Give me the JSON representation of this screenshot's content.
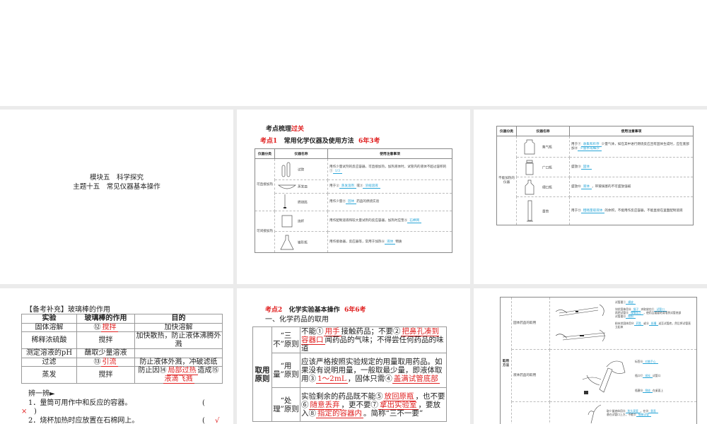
{
  "slide1": {
    "line1": "模块五　科学探究",
    "line2": "主题十五　常见仪器基本操作"
  },
  "slide2": {
    "heading_a": "考点梳理",
    "heading_b": "过关",
    "kp_label": "考点1",
    "kp_title": "常用化学仪器及使用方法",
    "kp_freq": "6年3考",
    "headers": [
      "仪器分类",
      "仪器名称",
      "使用注意事项"
    ],
    "groups": [
      "可直接加热",
      "可间接加热"
    ],
    "rows": [
      {
        "name": "试管",
        "pre": "用作少量试剂的反应容器，可直接加热，加热液体时，试管内的液体不超过容积的①",
        "a1": "1/3"
      },
      {
        "name": "蒸发皿",
        "pre": "用于②",
        "a1": "蒸发溶剂",
        "mid": "或③",
        "a2": "浓缩溶液"
      },
      {
        "name": "燃烧匙",
        "pre": "用作少量④",
        "a1": "固体",
        "post": "药品的燃烧实验"
      },
      {
        "name": "烧杯",
        "pre": "用作配制溶液和较大量试剂的反应容器，加热时应垫⑤",
        "a1": "石棉网"
      },
      {
        "name": "锥形瓶",
        "pre": "用作接收器，反应器等，常用于加热⑥",
        "a1": "液体",
        "post": "物质"
      }
    ]
  },
  "slide3": {
    "headers": [
      "仪器分类",
      "仪器名称",
      "使用注意事项"
    ],
    "group": "不能加热的仪器",
    "rows": [
      {
        "name": "集气瓶",
        "pre": "用于⑦",
        "a1": "收集和贮存",
        "mid": "少量气体，如在其中进行燃烧反应且有固体生成时，应在底部加⑧",
        "a2": "少量水或细沙"
      },
      {
        "name": "广口瓶",
        "pre": "盛放⑨",
        "a1": "固体"
      },
      {
        "name": "细口瓶",
        "pre": "盛放⑩",
        "a1": "液体",
        "post": "，带玻璃塞的不可盛放强碱"
      },
      {
        "name": "量筒",
        "pre": "用于⑪",
        "a1": "粗略量取液体",
        "post": "的体积，不能用作反应容器，不能直接在里面配制溶液"
      }
    ]
  },
  "slide4": {
    "title": "【备考补充】玻璃棒的作用",
    "headers": [
      "实验",
      "玻璃棒的作用",
      "目的"
    ],
    "rows": [
      {
        "exp": "固体溶解",
        "num": "⑫",
        "role": "搅拌",
        "purpose": "加快溶解"
      },
      {
        "exp": "稀释浓硫酸",
        "role": "搅拌",
        "purpose": "加快散热，防止液体沸腾外溅"
      },
      {
        "exp": "测定溶液的pH",
        "role": "蘸取少量溶液",
        "purpose": ""
      },
      {
        "exp": "过滤",
        "num": "⑬",
        "role": "引流",
        "purpose": "防止液体外溅，冲破滤纸"
      },
      {
        "exp": "蒸发",
        "role": "搅拌",
        "p_pre": "防止因⑭",
        "p_a1": "局部过热",
        "p_mid": "造成⑮",
        "p_a2": "液滴飞溅"
      }
    ],
    "quiz_title": "辨一辨►",
    "q1": "1．量筒可用作中和反应的容器。",
    "q1_ans": "×",
    "q2": "2．烧杯加热时应放置在石棉网上。",
    "q2_ans": "√",
    "paren_open": "(",
    "paren_close": ")"
  },
  "slide5": {
    "kp_label": "考点2",
    "kp_title": "化学实验基本操作",
    "kp_freq": "6年6考",
    "sub": "一、化学药品的取用",
    "group": "取用原则",
    "rows": [
      {
        "label": "“三不”原则",
        "t1": "不能①",
        "a1": "用手",
        "t2": "接触药品；不要②",
        "a2": "把鼻孔凑到容器口",
        "t3": "闻药品的气味；不得尝任何药品的味道"
      },
      {
        "label": "“用量”原则",
        "t1": "应该严格按照实验规定的用量取用药品。如果没有说明用量，一般取最少量，即液体取用③",
        "a1": "1～2mL",
        "t2": "，固体只需④",
        "a2": "盖满试管底部"
      },
      {
        "label": "“处理”原则",
        "t1": "实验剩余的药品既不能⑤",
        "a1": "放回原瓶",
        "t2": "，也不要⑥",
        "a2": "随意丢弃",
        "t3": "，更不要⑦",
        "a3": "拿出实验室",
        "t4": "，要放入⑧",
        "a4": "指定的容器内",
        "t5": "。简称“三不一要”"
      }
    ]
  },
  "slide6": {
    "group": "取用方法",
    "rows": [
      "固体药品的取用",
      "液体药品的取用"
    ],
    "notes": [
      {
        "pre": "试管要①",
        "a": "横放"
      },
      {
        "pre": "块状固体用⑩",
        "a": "镊子",
        "mid": "夹取放在⑪",
        "a2": "试管口"
      },
      {
        "pre": "再把试管⑫",
        "a": "慢慢竖立",
        "mid": "，使药品缓缓地滑落到试管底部"
      },
      {
        "pre": "试管要⑬",
        "a": "倾斜"
      },
      {
        "pre": "粉末状固体用⑭",
        "a": "药匙",
        "mid": "或⑮",
        "a2": "纸槽",
        "post": "送至试管底，然后将试管直立起来"
      },
      {
        "pre": "标签⑯",
        "a": "对着手心"
      },
      {
        "pre": "瓶口⑰",
        "a": "紧挨",
        "post": "试管口"
      },
      {
        "pre": "瓶塞⑱",
        "a": "倒放",
        "post": "在桌面上"
      },
      {
        "pre": "取少量液体用⑲",
        "a": "胶头滴管",
        "mid": "，在⑳",
        "a2": "垂直"
      },
      {
        "pre": "悬在试管口上方，不能㉑",
        "a": "接触试管"
      }
    ]
  }
}
